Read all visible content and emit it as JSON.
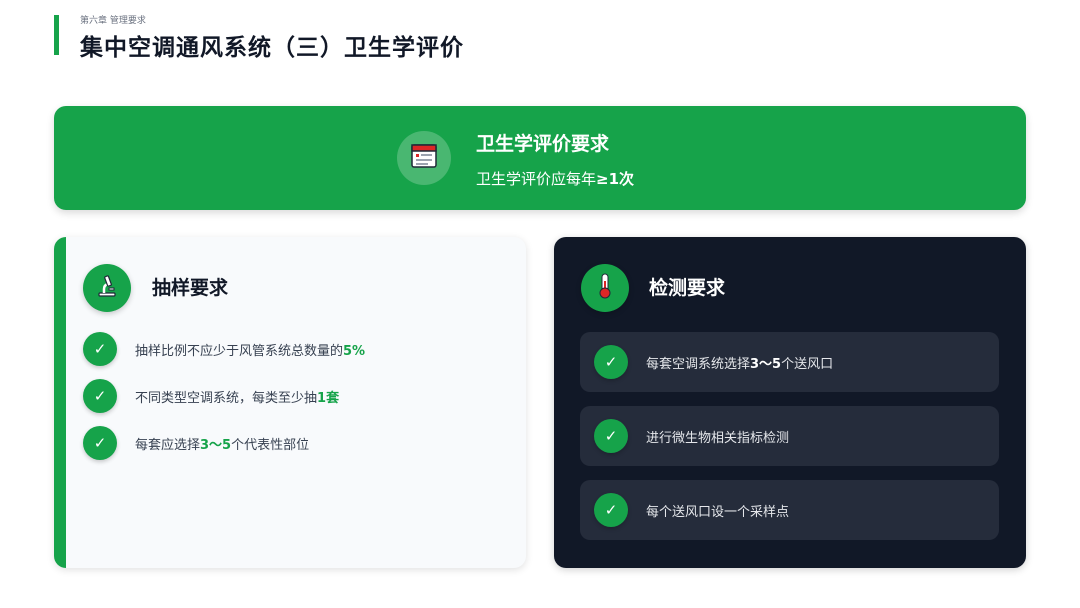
{
  "header": {
    "chapter": "第六章 管理要求",
    "title": "集中空调通风系统（三）卫生学评价"
  },
  "banner": {
    "icon": "calendar-icon",
    "title": "卫生学评价要求",
    "subtitle_prefix": "卫生学评价应每年",
    "subtitle_highlight": "≥1次"
  },
  "sampling": {
    "icon": "microscope-icon",
    "title": "抽样要求",
    "items": [
      {
        "text": "抽样比例不应少于风管系统总数量的",
        "highlight": "5%",
        "suffix": ""
      },
      {
        "text": "不同类型空调系统，每类至少抽",
        "highlight": "1",
        "suffix": "套"
      },
      {
        "text": "每套应选择",
        "highlight": "3～5",
        "suffix": "个代表性部位"
      }
    ]
  },
  "testing": {
    "icon": "thermometer-icon",
    "title": "检测要求",
    "items": [
      {
        "text": "每套空调系统选择",
        "highlight": "3～5",
        "suffix": "个送风口"
      },
      {
        "text": "进行微生物相关指标检测",
        "highlight": "",
        "suffix": ""
      },
      {
        "text": "每个送风口设一个采样点",
        "highlight": "",
        "suffix": ""
      }
    ]
  },
  "colors": {
    "accent": "#16a34a",
    "dark_card": "#111827",
    "dark_item": "#252c3b"
  }
}
